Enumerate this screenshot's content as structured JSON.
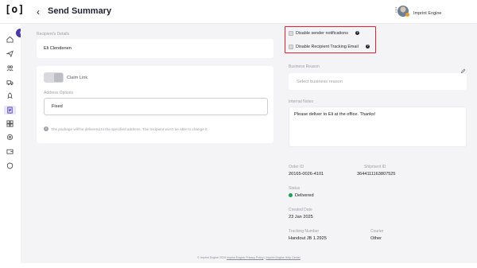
{
  "app": {
    "logo": "[o]",
    "title": "Send Summary",
    "user": "Imprint Engine"
  },
  "left": {
    "recipient_label": "Recipient's Details",
    "recipient_value": "Eli Clendenen",
    "claim_link_label": "Claim Link",
    "address_options_label": "Address Options",
    "address_options_value": "Fixed",
    "info_text": "The package will be delivered to the specified address. The recipient won't be able to change it."
  },
  "right": {
    "checks": [
      {
        "label": "Disable sender notifications"
      },
      {
        "label": "Disable Recipient Tracking Email"
      }
    ],
    "business_reason_label": "Business Reason",
    "business_reason_placeholder": "Select business reason",
    "internal_notes_label": "Internal Notes",
    "internal_notes_value": "Please deliver to Eli at the office. Thanks!",
    "order_id_label": "Order ID",
    "order_id_value": "20165-0026-4101",
    "shipment_id_label": "Shipment ID",
    "shipment_id_value": "3644111163807525",
    "status_label": "Status",
    "status_value": "Delivered",
    "created_date_label": "Created Date",
    "created_date_value": "23 Jan 2025",
    "tracking_label": "Tracking Number",
    "tracking_value": "Handout JB 1.2925",
    "courier_label": "Courier",
    "courier_value": "Other"
  },
  "footer": {
    "copyright": "© Imprint Engine 2025",
    "privacy": "Imprint Engine Privacy Policy",
    "separator": "|",
    "help": "Imprint Engine Help Center"
  },
  "colors": {
    "accent": "#4a3aa8",
    "highlight_border": "#e0202f",
    "status_green": "#1aa05a"
  },
  "icons": [
    "home-icon",
    "send-icon",
    "people-icon",
    "truck-icon",
    "rocket-icon",
    "receipt-icon",
    "grid-icon",
    "gear-icon",
    "wallet-icon",
    "shield-icon"
  ]
}
